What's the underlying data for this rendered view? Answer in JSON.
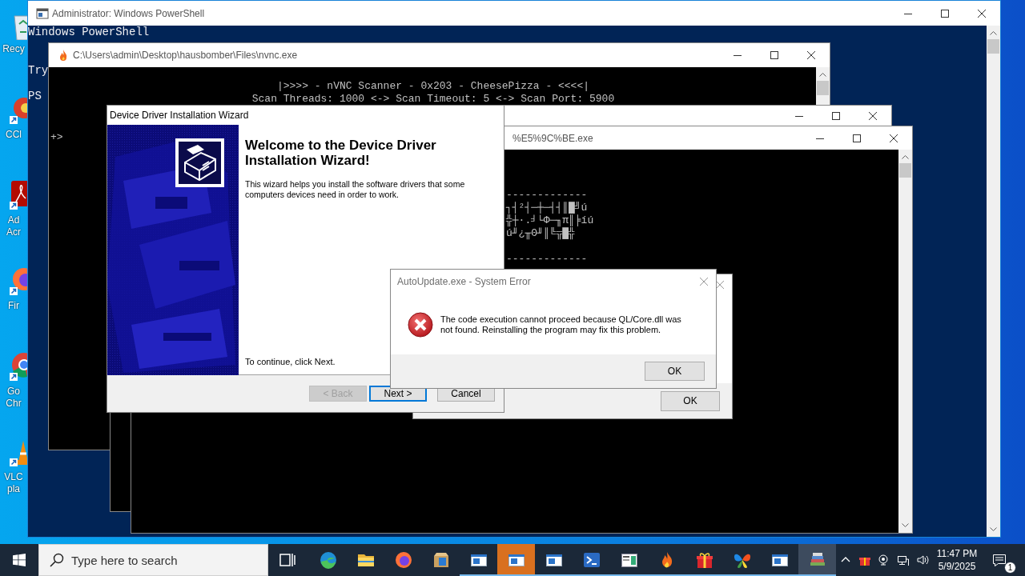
{
  "desktop_icons": [
    {
      "kind": "recycle",
      "label": [
        "Recy"
      ]
    },
    {
      "kind": "cleaner",
      "label": [
        "CCl"
      ]
    },
    {
      "kind": "acrobat",
      "label": [
        "Ad",
        "Acr"
      ]
    },
    {
      "kind": "firefox",
      "label": [
        "Fir"
      ]
    },
    {
      "kind": "chrome",
      "label": [
        "Go",
        "Chr"
      ]
    },
    {
      "kind": "vlc",
      "label": [
        "VLC",
        "pla"
      ]
    }
  ],
  "windows": [
    {
      "kind": "powershell",
      "title": "Administrator: Windows PowerShell",
      "output": [
        [
          "Windows PowerShell"
        ],
        [
          "Try"
        ],
        [
          "PS"
        ]
      ]
    },
    {
      "kind": "console",
      "title": "C:\\Users\\admin\\Desktop\\hausbomber\\Files\\nvnc.exe",
      "banner": [
        "|>>>> - nVNC Scanner - 0x203 - CheesePizza - <<<<|",
        "Scan Threads: 1000 <-> Scan Timeout: 5 <-> Scan Port: 5900"
      ],
      "output": [
        [
          "+>"
        ]
      ]
    },
    {
      "kind": "console"
    },
    {
      "kind": "console",
      "title": "%E5%9C%BE.exe",
      "output": [
        [
          "-------------",
          "┐┤²┤─┼─┤┤║█╝ú",
          "╬┼·.╛└Φ─╖π║╞íú",
          "ú╜¿╥Θ╜║╚╦█╬"
        ],
        [
          "-------------"
        ]
      ]
    },
    {
      "kind": "dialog",
      "buttons": [
        {
          "label": "OK"
        }
      ]
    },
    {
      "kind": "wizard",
      "title": "Device Driver Installation Wizard",
      "heading": "Welcome to the Device Driver Installation Wizard!",
      "text": "This wizard helps you install the software drivers that some computers devices need in order to work.",
      "instruction": "To continue, click Next.",
      "buttons": [
        {
          "label": "< Back",
          "disabled": true,
          "default": false
        },
        {
          "label": "Next >",
          "disabled": false,
          "default": true
        },
        {
          "label": "Cancel",
          "disabled": false,
          "default": false
        }
      ]
    },
    {
      "kind": "error",
      "title": "AutoUpdate.exe - System Error",
      "message": "The code execution cannot proceed because QL/Core.dll was not found. Reinstalling the program may fix this problem.",
      "buttons": [
        {
          "label": "OK"
        }
      ]
    }
  ],
  "taskbar": {
    "search": {
      "placeholder": "Type here to search"
    },
    "items": [
      {
        "kind": "swirl",
        "running": false,
        "selected": false,
        "flashing": false
      },
      {
        "kind": "folder",
        "running": false,
        "selected": false,
        "flashing": false
      },
      {
        "kind": "firefox",
        "running": false,
        "selected": false,
        "flashing": false
      },
      {
        "kind": "package",
        "running": false,
        "selected": false,
        "flashing": false
      },
      {
        "kind": "window",
        "running": true,
        "selected": false,
        "flashing": false
      },
      {
        "kind": "window",
        "running": true,
        "selected": false,
        "flashing": true
      },
      {
        "kind": "window",
        "running": true,
        "selected": false,
        "flashing": false
      },
      {
        "kind": "terminal",
        "running": true,
        "selected": false,
        "flashing": false
      },
      {
        "kind": "panel",
        "running": true,
        "selected": false,
        "flashing": false
      },
      {
        "kind": "flame",
        "running": true,
        "selected": false,
        "flashing": false
      },
      {
        "kind": "gift",
        "running": true,
        "selected": false,
        "flashing": false
      },
      {
        "kind": "butterfly",
        "running": true,
        "selected": false,
        "flashing": false
      },
      {
        "kind": "window",
        "running": true,
        "selected": false,
        "flashing": false
      },
      {
        "kind": "books",
        "running": true,
        "selected": true,
        "flashing": false
      }
    ],
    "tray_icons": [
      {
        "kind": "chevron"
      },
      {
        "kind": "gift"
      },
      {
        "kind": "webcam"
      },
      {
        "kind": "network"
      },
      {
        "kind": "volume"
      }
    ],
    "time": "11:47 PM",
    "date": "5/9/2025",
    "notifications": "1"
  }
}
